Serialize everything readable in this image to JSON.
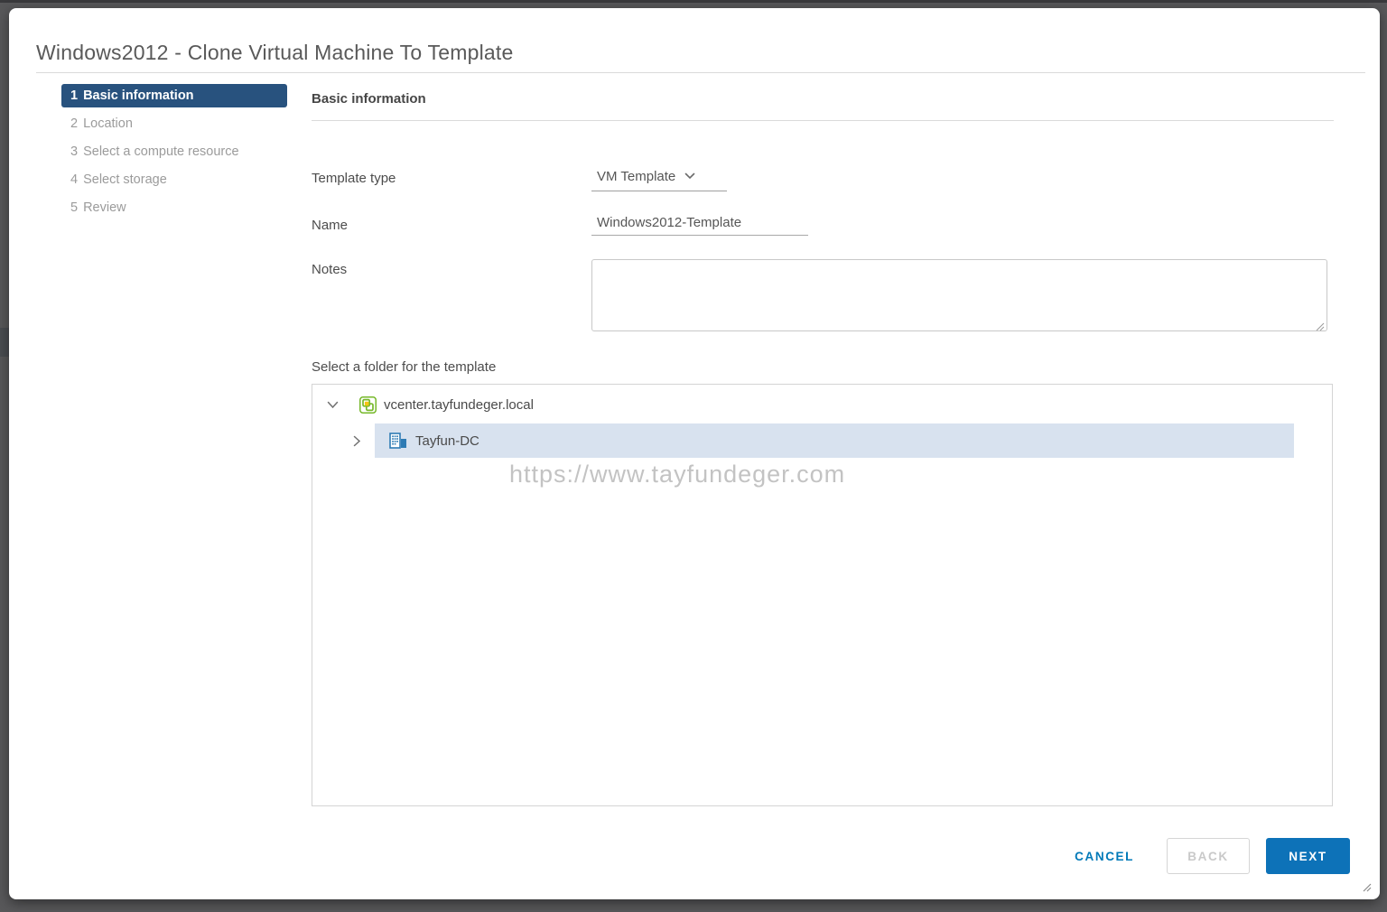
{
  "dialog": {
    "title": "Windows2012 - Clone Virtual Machine To Template",
    "steps": [
      {
        "number": "1",
        "label": "Basic information",
        "active": true
      },
      {
        "number": "2",
        "label": "Location",
        "active": false
      },
      {
        "number": "3",
        "label": "Select a compute resource",
        "active": false
      },
      {
        "number": "4",
        "label": "Select storage",
        "active": false
      },
      {
        "number": "5",
        "label": "Review",
        "active": false
      }
    ],
    "section_title": "Basic information",
    "form": {
      "template_type_label": "Template type",
      "template_type_value": "VM Template",
      "name_label": "Name",
      "name_value": "Windows2012-Template",
      "notes_label": "Notes",
      "notes_value": ""
    },
    "folder_section": {
      "label": "Select a folder for the template",
      "tree": [
        {
          "label": "vcenter.tayfundeger.local",
          "icon": "vcenter-icon",
          "state": "expanded"
        },
        {
          "label": "Tayfun-DC",
          "icon": "datacenter-icon",
          "state": "collapsed",
          "selected": true
        }
      ]
    },
    "watermark": "https://www.tayfundeger.com",
    "footer": {
      "cancel_label": "CANCEL",
      "back_label": "BACK",
      "next_label": "NEXT"
    }
  },
  "colors": {
    "accent_blue": "#0079b8",
    "next_button_bg": "#0d72b8",
    "active_step_bg": "#28527e",
    "tree_selection_bg": "#d8e2ef",
    "vcenter_icon_green": "#76b82a",
    "vcenter_icon_yellow": "#f5c415",
    "datacenter_icon_blue": "#2e7bb4",
    "backdrop": "#58585a"
  }
}
